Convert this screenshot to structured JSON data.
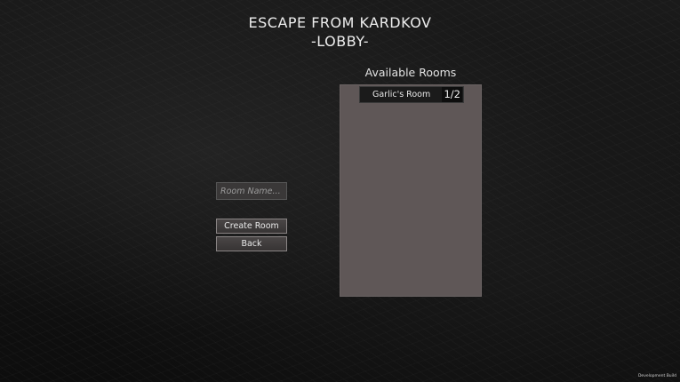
{
  "header": {
    "title": "ESCAPE FROM KARDKOV",
    "subtitle": "-LOBBY-"
  },
  "rooms": {
    "heading": "Available Rooms",
    "items": [
      {
        "name": "Garlic's Room",
        "count": "1/2"
      }
    ]
  },
  "form": {
    "room_name_placeholder": "Room Name...",
    "room_name_value": "",
    "create_label": "Create Room",
    "back_label": "Back"
  },
  "footer": {
    "build_label": "Development Build"
  },
  "colors": {
    "background": "#111111",
    "panel": "#5f5757",
    "room_item": "#1b1b1b",
    "button": "#3f3c3c",
    "text": "#e6e6e6"
  }
}
